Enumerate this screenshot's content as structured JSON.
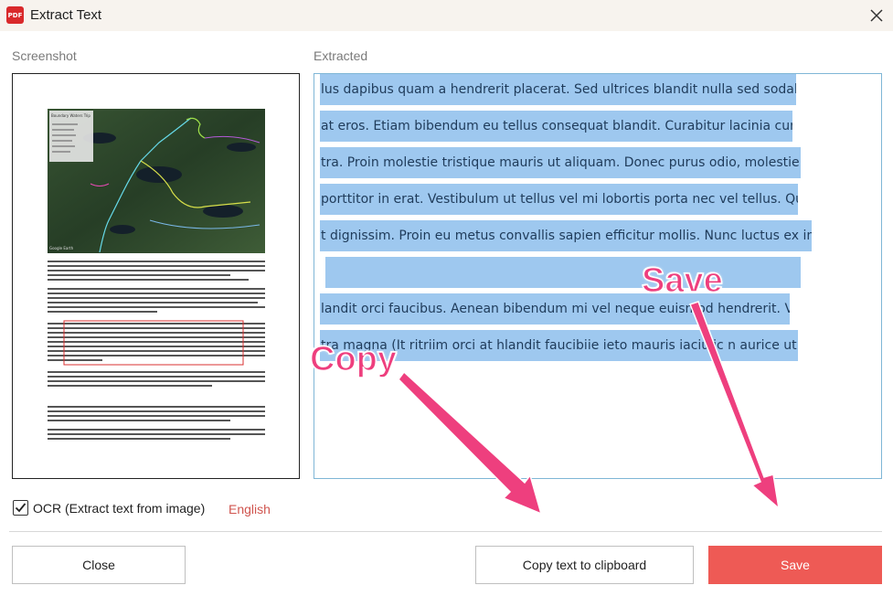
{
  "window": {
    "title": "Extract Text",
    "app_icon_text": "PDF",
    "close_icon": "close-icon"
  },
  "screenshot_panel": {
    "label": "Screenshot",
    "map_legend_title": "Boundary Waters Trip",
    "map_watermark": "Google Earth"
  },
  "extracted_panel": {
    "label": "Extracted",
    "lines": [
      "lus dapibus quam a hendrerit placerat. Sed ultrices blandit nulla sed sodales. |",
      "at eros. Etiam bibendum eu tellus consequat blandit. Curabitur lacinia cursus",
      "tra. Proin molestie tristique mauris ut aliquam. Donec purus odio, molestie id s",
      "porttitor in erat. Vestibulum ut tellus vel mi lobortis porta nec vel tellus. Quisqu",
      "t dignissim. Proin eu metus convallis sapien efficitur mollis. Nunc luctus ex in nut",
      "",
      "landit orci faucibus. Aenean bibendum mi vel neque euismod hendrerit. Vesti",
      "tra magna (It ritriim orci at hlandit faucibiie ieto mauris iaciulic n aurice ut tem"
    ]
  },
  "ocr": {
    "checked": true,
    "label": "OCR (Extract text from image)",
    "language": "English"
  },
  "buttons": {
    "close": "Close",
    "copy": "Copy text to clipboard",
    "save": "Save"
  },
  "annotations": {
    "copy_label": "Copy",
    "save_label": "Save",
    "color": "#ee3f7e"
  },
  "colors": {
    "save_button": "#ee5a55",
    "highlight": "#9ec8ef",
    "language": "#d0554f"
  }
}
